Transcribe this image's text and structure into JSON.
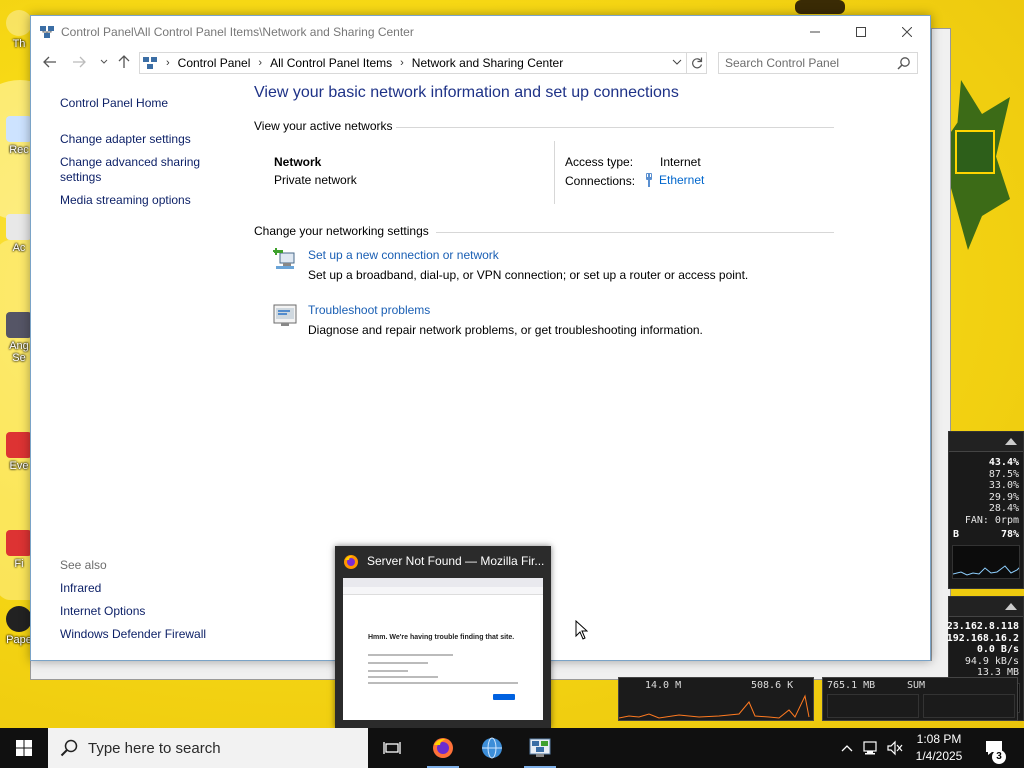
{
  "window": {
    "title": "Control Panel\\All Control Panel Items\\Network and Sharing Center"
  },
  "address": {
    "crumbs": [
      "Control Panel",
      "All Control Panel Items",
      "Network and Sharing Center"
    ],
    "search_placeholder": "Search Control Panel"
  },
  "sidebar": {
    "home": "Control Panel Home",
    "links": [
      "Change adapter settings",
      "Change advanced sharing",
      "settings",
      "Media streaming options"
    ],
    "see_also_label": "See also",
    "see_also": [
      "Infrared",
      "Internet Options",
      "Windows Defender Firewall"
    ]
  },
  "main": {
    "heading": "View your basic network information and set up connections",
    "active_networks_title": "View your active networks",
    "network": {
      "name": "Network",
      "type": "Private network",
      "access_label": "Access type:",
      "access_value": "Internet",
      "connections_label": "Connections:",
      "connections_value": "Ethernet"
    },
    "change_settings_title": "Change your networking settings",
    "tasks": [
      {
        "link": "Set up a new connection or network",
        "desc": "Set up a broadband, dial-up, or VPN connection; or set up a router or access point.",
        "icon": "network-setup-icon"
      },
      {
        "link": "Troubleshoot problems",
        "desc": "Diagnose and repair network problems, or get troubleshooting information.",
        "icon": "troubleshoot-icon"
      }
    ]
  },
  "preview": {
    "title": "Server Not Found — Mozilla Fir...",
    "page_message": "Hmm. We're having trouble finding that site."
  },
  "monitor": {
    "cpu_total": "43.4%",
    "cpu_cores": [
      "87.5%",
      "33.0%",
      "29.9%",
      "28.4%"
    ],
    "fan": "FAN: 0rpm",
    "mem_suffix": "B",
    "mem_pct": "78%",
    "ip_public": "23.162.8.118",
    "ip_local": "192.168.16.2",
    "up": "0.0 B/s",
    "down": "94.9 kB/s",
    "total": "13.3 MB"
  },
  "strips": {
    "a1": "14.0 M",
    "a2": "508.6 K",
    "b1": "765.1 MB",
    "b2": "SUM"
  },
  "desktop_icons": [
    "Th",
    "Rec",
    "Ac",
    "Ang",
    "Se",
    "Eve",
    "Fi",
    "Pape"
  ],
  "taskbar": {
    "search_placeholder": "Type here to search",
    "time": "1:08 PM",
    "date": "1/4/2025",
    "notifications": "3"
  },
  "colors": {
    "link": "#1a5fb4",
    "heading": "#1e3287",
    "desktop": "#f4dc12",
    "taskbar": "#101010"
  }
}
